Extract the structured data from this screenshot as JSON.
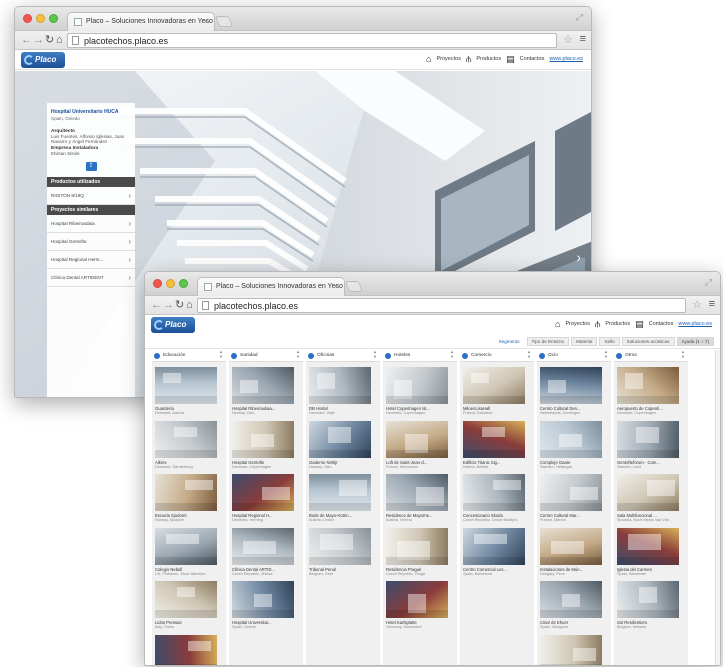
{
  "browser": {
    "tab_title": "Placo – Soluciones Innovadoras en Yeso",
    "tab_close": "×",
    "url": "placotechos.placo.es"
  },
  "site": {
    "logo_text": "Placo",
    "nav": {
      "proyectos": "Proyectos",
      "productos": "Productos",
      "contactos": "Contactos",
      "link": "www.placo.es"
    }
  },
  "detail_panel": {
    "project_title": "Hospital Universitario HUCA",
    "location": "Spain, Oviedo",
    "section_architect": "Arquitecto",
    "architect_text": "Luis Fuentes, Alfonso Iglesias, Juan Navarro y Ángel Fernández",
    "section_installer": "Empresa Instaladora",
    "installer_text": "Elvisan Sisole",
    "section_products": "Productos utilizados",
    "products": [
      "RIGITON 8/18Q"
    ],
    "section_similar": "Proyectos similares",
    "similar": [
      "Hospital Ribeiroadaia",
      "Hospital Gentofte",
      "Hospital Regional Herm..."
    ],
    "extra_item": "Clínica Dental ARTIDENT"
  },
  "filters": [
    "Segmento",
    "Tipo de Entorno",
    "Material",
    "Sello",
    "Soluciones acústicas",
    "Ayuda (1 ÷ 7)"
  ],
  "columns": [
    {
      "name": "Educación",
      "cards": [
        {
          "title": "Guardería",
          "sub": "Denmark, Aarhus"
        },
        {
          "title": "Alkrex",
          "sub": "Denmark, Sønderborg"
        },
        {
          "title": "Escuela Sjodoret",
          "sub": "Norway, Sjodoret"
        },
        {
          "title": "Colegio Nebull",
          "sub": "UK, Pinhaven, Wool Valentine"
        },
        {
          "title": "Lidos Prensas",
          "sub": "Italy, Torino"
        },
        {
          "title": "",
          "sub": ""
        }
      ]
    },
    {
      "name": "Sanidad",
      "cards": [
        {
          "title": "Hospital Ribeiroadaia...",
          "sub": "Norway, Oslo"
        },
        {
          "title": "Hospital Gentofte",
          "sub": "Denmark, Copenhagen"
        },
        {
          "title": "Hospital Regional H...",
          "sub": "Denmark, Herning"
        },
        {
          "title": "Clínica Dental ARTID...",
          "sub": "Czech Republic, Jihlava"
        },
        {
          "title": "Hospital Universitar...",
          "sub": "Spain, Oviedo"
        }
      ]
    },
    {
      "name": "Oficinas",
      "cards": [
        {
          "title": "DB Hostel",
          "sub": "Denmark, Vejle"
        },
        {
          "title": "Gaderne Nörkjr",
          "sub": "Norway, Oslo"
        },
        {
          "title": "Bode de Mayo-Hotrin...",
          "sub": "Austria, Linden"
        },
        {
          "title": "Tribunal Penal",
          "sub": "Belgium, Gent"
        }
      ]
    },
    {
      "name": "Hoteles",
      "cards": [
        {
          "title": "Hotel Copenhagen Isl...",
          "sub": "Denmark, Copenhagen"
        },
        {
          "title": "Loft de Saint-Jean-d...",
          "sub": "France, Mormoiron"
        },
        {
          "title": "Residence de Mayorne...",
          "sub": "Austria, Vienna"
        },
        {
          "title": "Residencia Pragué",
          "sub": "Czech Republic, Praga"
        },
        {
          "title": "Hotel Karlsplatte",
          "sub": "Germany, Düsseldorf"
        }
      ]
    },
    {
      "name": "Comercio",
      "cards": [
        {
          "title": "MiloenLisaHall",
          "sub": "Poland, Katowice"
        },
        {
          "title": "Edificio Titanic Sig...",
          "sub": "Ireland, Belfast"
        },
        {
          "title": "Concesionario Skoda",
          "sub": "Czech Republic, České Budějov."
        },
        {
          "title": "Centro Comercial Lex...",
          "sub": "Spain, Barcelona"
        }
      ]
    },
    {
      "name": "Ocio",
      "cards": [
        {
          "title": "Centro Cultural Den...",
          "sub": "Netherlands, Groningen"
        },
        {
          "title": "Complejo Gaare",
          "sub": "Sweden, Helsingør"
        },
        {
          "title": "Centro Cultural Mar...",
          "sub": "France, Maroni"
        },
        {
          "title": "Instalaciones de Mún...",
          "sub": "Hungary, Pécs"
        },
        {
          "title": "Cinar de Ehuer",
          "sub": "Spain, Zaragoza"
        },
        {
          "title": "",
          "sub": ""
        }
      ]
    },
    {
      "name": "Otros",
      "cards": [
        {
          "title": "Aeropuerto de Copenh...",
          "sub": "Denmark, Copenhagen"
        },
        {
          "title": "Gentofteforum - Com...",
          "sub": "Sweden, Lund"
        },
        {
          "title": "Sala Multifuncional ...",
          "sub": "Slovakia, Nové Mesto nad Váh."
        },
        {
          "title": "Iglesia del Carmen",
          "sub": "Spain, Santander"
        },
        {
          "title": "Sol Resilientiem",
          "sub": "Belgium, Antwerp"
        }
      ]
    }
  ],
  "colors": {
    "brand_blue": "#1d4f99",
    "accent_blue": "#2b6fc1",
    "panel_bar": "#4a4a4a"
  }
}
